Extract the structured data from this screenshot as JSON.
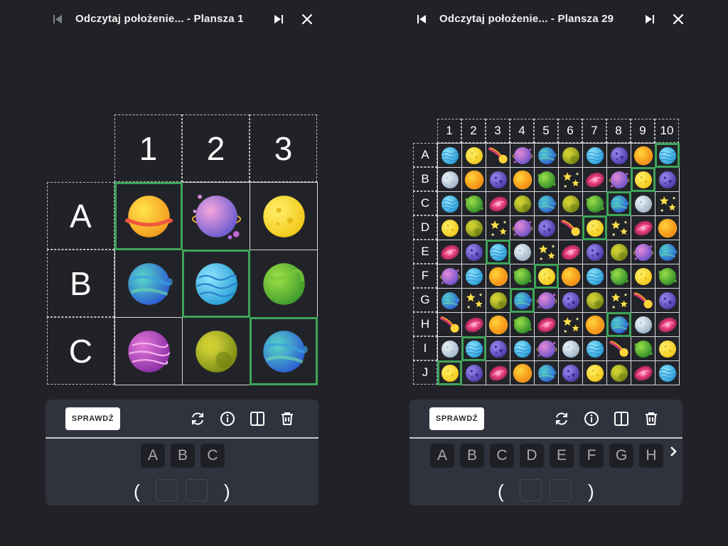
{
  "colors": {
    "background": "#212227",
    "selection": "#3fa45a",
    "toolbar": "#30323e"
  },
  "icons": {
    "first": "skip-previous-icon",
    "last": "skip-next-icon",
    "close": "close-icon",
    "refresh": "refresh-icon",
    "info": "info-icon",
    "split": "split-view-icon",
    "trash": "trash-icon",
    "more": "chevron-right-icon"
  },
  "panels": [
    {
      "title": "Odczytaj położenie... - Plansza 1",
      "columns": [
        "1",
        "2",
        "3"
      ],
      "rows": [
        "A",
        "B",
        "C"
      ],
      "grid": [
        [
          "ringed-orange",
          "pink-moons",
          "yellow-moon"
        ],
        [
          "teal-planet",
          "blue-waves",
          "green-planet"
        ],
        [
          "purple-stripes",
          "olive-planet",
          "teal-planet"
        ]
      ],
      "highlighted": [
        [
          0,
          0
        ],
        [
          1,
          1
        ],
        [
          2,
          2
        ]
      ],
      "toolbar": {
        "check_label": "SPRAWDŹ",
        "keys": [
          "A",
          "B",
          "C"
        ],
        "open_paren": "(",
        "close_paren": ")",
        "has_more": false
      }
    },
    {
      "title": "Odczytaj położenie... - Plansza 29",
      "columns": [
        "1",
        "2",
        "3",
        "4",
        "5",
        "6",
        "7",
        "8",
        "9",
        "10"
      ],
      "rows": [
        "A",
        "B",
        "C",
        "D",
        "E",
        "F",
        "G",
        "H",
        "I",
        "J"
      ],
      "grid": [
        [
          "blue-waves",
          "yellow-moon",
          "comet",
          "ringed-purple",
          "teal-planet",
          "olive-planet",
          "blue-waves",
          "violet-planet",
          "sun",
          "blue-waves"
        ],
        [
          "grey-moon",
          "sun",
          "violet-planet",
          "sun",
          "green-ringed",
          "stars",
          "pink-galaxy",
          "ringed-purple",
          "yellow-moon",
          "violet-planet"
        ],
        [
          "blue-waves",
          "green-ringed",
          "pink-galaxy",
          "olive-planet",
          "teal-planet",
          "olive-planet",
          "green-ringed",
          "teal-planet",
          "grey-moon",
          "stars"
        ],
        [
          "yellow-moon",
          "olive-planet",
          "stars",
          "ringed-purple",
          "violet-planet",
          "comet",
          "yellow-moon",
          "stars",
          "pink-galaxy",
          "sun"
        ],
        [
          "pink-galaxy",
          "violet-planet",
          "blue-waves",
          "grey-moon",
          "stars",
          "pink-galaxy",
          "violet-planet",
          "olive-planet",
          "ringed-purple",
          "teal-planet"
        ],
        [
          "ringed-purple",
          "blue-waves",
          "sun",
          "green-ringed",
          "yellow-moon",
          "sun",
          "blue-waves",
          "green-ringed",
          "yellow-moon",
          "green-ringed"
        ],
        [
          "teal-planet",
          "stars",
          "olive-planet",
          "teal-planet",
          "ringed-purple",
          "violet-planet",
          "olive-planet",
          "stars",
          "comet",
          "violet-planet"
        ],
        [
          "comet",
          "pink-galaxy",
          "sun",
          "green-ringed",
          "pink-galaxy",
          "stars",
          "sun",
          "teal-planet",
          "grey-moon",
          "pink-galaxy"
        ],
        [
          "grey-moon",
          "blue-waves",
          "violet-planet",
          "blue-waves",
          "ringed-purple",
          "grey-moon",
          "blue-waves",
          "comet",
          "green-ringed",
          "yellow-moon"
        ],
        [
          "yellow-moon",
          "violet-planet",
          "pink-galaxy",
          "sun",
          "teal-planet",
          "violet-planet",
          "yellow-moon",
          "olive-planet",
          "pink-galaxy",
          "blue-waves"
        ]
      ],
      "highlighted": [
        [
          0,
          9
        ],
        [
          1,
          8
        ],
        [
          2,
          7
        ],
        [
          3,
          6
        ],
        [
          4,
          2
        ],
        [
          5,
          4
        ],
        [
          6,
          3
        ],
        [
          7,
          7
        ],
        [
          8,
          1
        ],
        [
          9,
          0
        ]
      ],
      "toolbar": {
        "check_label": "SPRAWDŹ",
        "keys": [
          "A",
          "B",
          "C",
          "D",
          "E",
          "F",
          "G",
          "H"
        ],
        "open_paren": "(",
        "close_paren": ")",
        "has_more": true
      }
    }
  ]
}
